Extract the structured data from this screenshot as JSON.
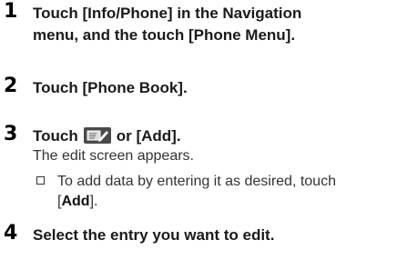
{
  "steps": [
    {
      "number": "1",
      "title_lines": [
        "Touch [Info/Phone] in the Navigation",
        "menu, and the touch [Phone Menu]."
      ]
    },
    {
      "number": "2",
      "title": "Touch [Phone Book]."
    },
    {
      "number": "3",
      "title_prefix": "Touch",
      "title_suffix": "or [Add].",
      "icon": "edit-entry-icon",
      "description": "The edit screen appears.",
      "note": {
        "line1": "To add data by entering it as desired, touch",
        "line2_open": "[",
        "line2_bold": "Add",
        "line2_close": "]."
      }
    },
    {
      "number": "4",
      "title": "Select the entry you want to edit."
    }
  ]
}
